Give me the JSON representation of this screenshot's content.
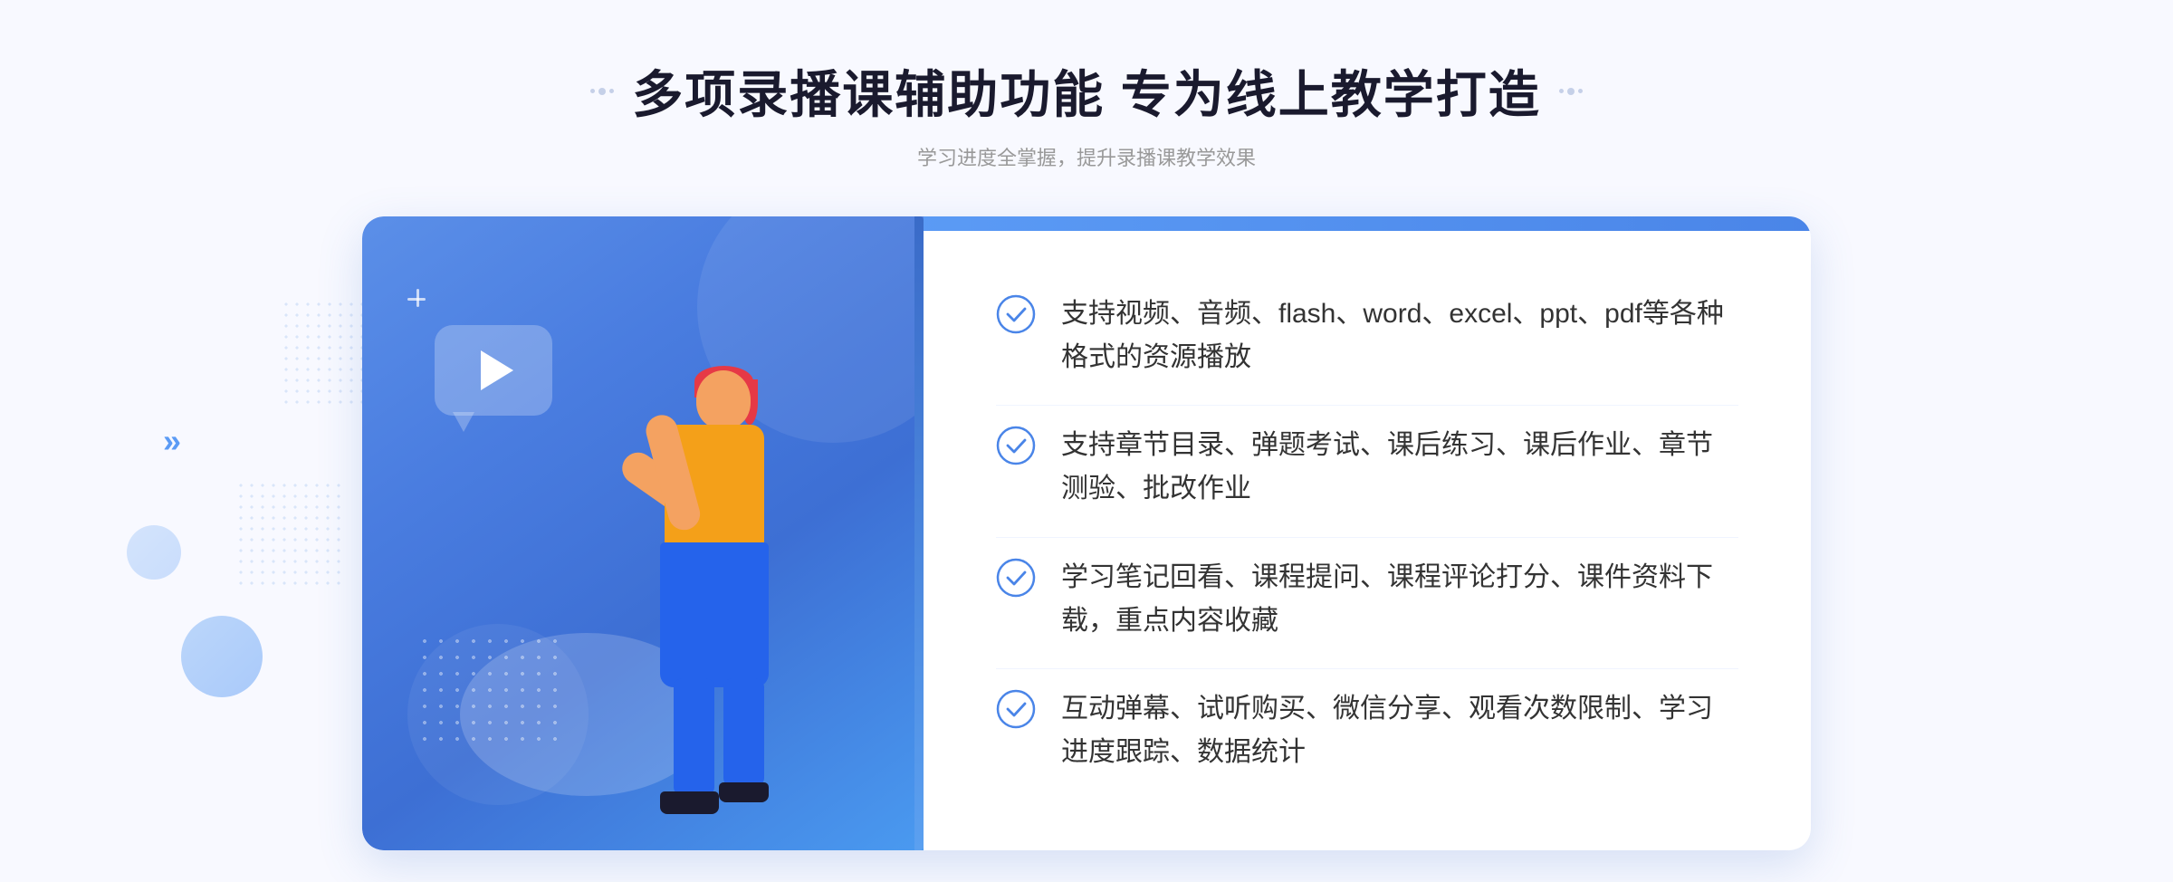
{
  "page": {
    "background": "#f8f9ff"
  },
  "header": {
    "main_title": "多项录播课辅助功能 专为线上教学打造",
    "subtitle": "学习进度全掌握，提升录播课教学效果",
    "decorator_left": "⁚",
    "decorator_right": "⁚"
  },
  "features": [
    {
      "id": 1,
      "text": "支持视频、音频、flash、word、excel、ppt、pdf等各种格式的资源播放"
    },
    {
      "id": 2,
      "text": "支持章节目录、弹题考试、课后练习、课后作业、章节测验、批改作业"
    },
    {
      "id": 3,
      "text": "学习笔记回看、课程提问、课程评论打分、课件资料下载，重点内容收藏"
    },
    {
      "id": 4,
      "text": "互动弹幕、试听购买、微信分享、观看次数限制、学习进度跟踪、数据统计"
    }
  ],
  "colors": {
    "primary_blue": "#4a85e8",
    "light_blue": "#7fb3f5",
    "text_dark": "#1a1a2e",
    "text_medium": "#333333",
    "text_light": "#999999",
    "check_blue": "#4a85e8",
    "background": "#f8f9ff"
  }
}
